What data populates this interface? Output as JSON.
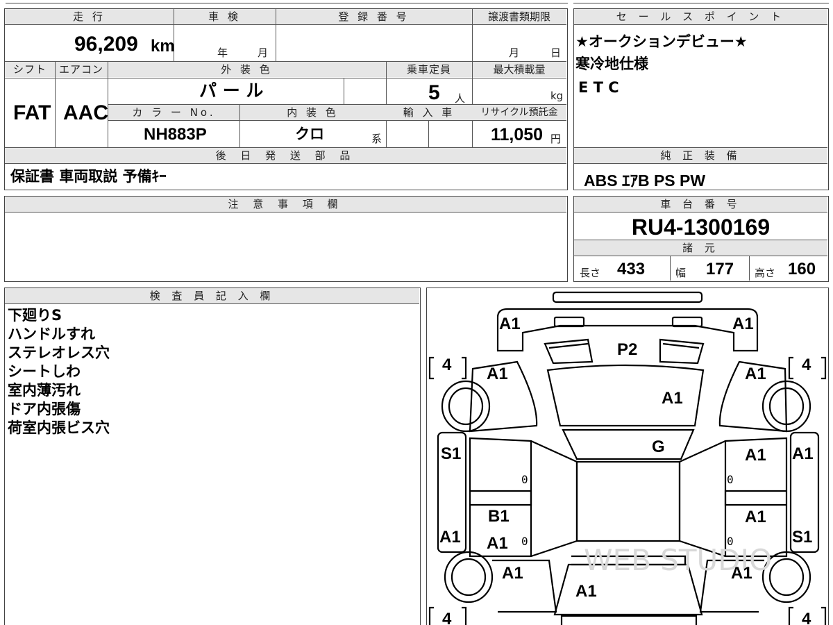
{
  "top_info": {
    "mileage_label": "走 行",
    "mileage_value": "96,209",
    "mileage_unit": "km",
    "inspection_label": "車 検",
    "inspection_year": "年",
    "inspection_month": "月",
    "registration_label": "登 録 番 号",
    "transfer_label": "譲渡書類期限",
    "transfer_month": "月",
    "transfer_day": "日"
  },
  "specs": {
    "shift_label": "シフト",
    "shift_value": "FAT",
    "ac_label": "エアコン",
    "ac_value": "AAC",
    "exterior_label": "外 装 色",
    "exterior_value": "パ ー ル",
    "capacity_label": "乗車定員",
    "capacity_value": "5",
    "capacity_unit": "人",
    "max_load_label": "最大積載量",
    "max_load_unit": "kg",
    "color_no_label": "カ ラ ー No.",
    "color_no_value": "NH883P",
    "interior_label": "内 装 色",
    "interior_value": "クロ",
    "interior_suffix": "系",
    "import_label": "輸 入 車",
    "recycle_label": "リサイクル預託金",
    "recycle_value": "11,050",
    "recycle_unit": "円"
  },
  "delivery": {
    "label": "後 日 発 送 部 品",
    "value": "保証書 車両取説 予備ｷｰ"
  },
  "sales_points": {
    "label": "セ ー ル ス ポ イ ン ト",
    "lines": [
      "★オークションデビュー★",
      "寒冷地仕様",
      "E T C"
    ]
  },
  "equipment": {
    "label": "純 正 装 備",
    "value": "ABS ｴｱB PS PW"
  },
  "notes": {
    "label": "注 意 事 項 欄"
  },
  "chassis": {
    "label": "車 台 番 号",
    "value": "RU4-1300169"
  },
  "dimensions": {
    "label": "諸 元",
    "length_label": "長さ",
    "length_value": "433",
    "width_label": "幅",
    "width_value": "177",
    "height_label": "高さ",
    "height_value": "160"
  },
  "inspector": {
    "label": "検 査 員 記 入 欄",
    "lines": [
      "下廻りS",
      "ハンドルすれ",
      "ステレオレス穴",
      "シートしわ",
      "室内薄汚れ",
      "ドア内張傷",
      "荷室内張ビス穴"
    ]
  },
  "diagram": {
    "marks": {
      "front_left": "A1",
      "front_right": "A1",
      "grille": "P2",
      "fender_front_left": "A1",
      "fender_front_right": "A1",
      "hood": "A1",
      "windshield": "G",
      "sill_front_left": "S1",
      "door_front_right": "A1",
      "sill_front_right": "A1",
      "door_rear_left_b": "B1",
      "door_rear_left_a": "A1",
      "sill_rear_left": "A1",
      "door_rear_right": "A1",
      "sill_rear_right": "S1",
      "quarter_left": "A1",
      "quarter_right": "A1",
      "rear": "A1"
    },
    "tires": {
      "front_left": "4",
      "front_right": "4",
      "rear_left": "4",
      "rear_right": "4"
    },
    "zeros": [
      "0",
      "0",
      "0",
      "0"
    ],
    "watermark": "WEB STUDIO"
  }
}
